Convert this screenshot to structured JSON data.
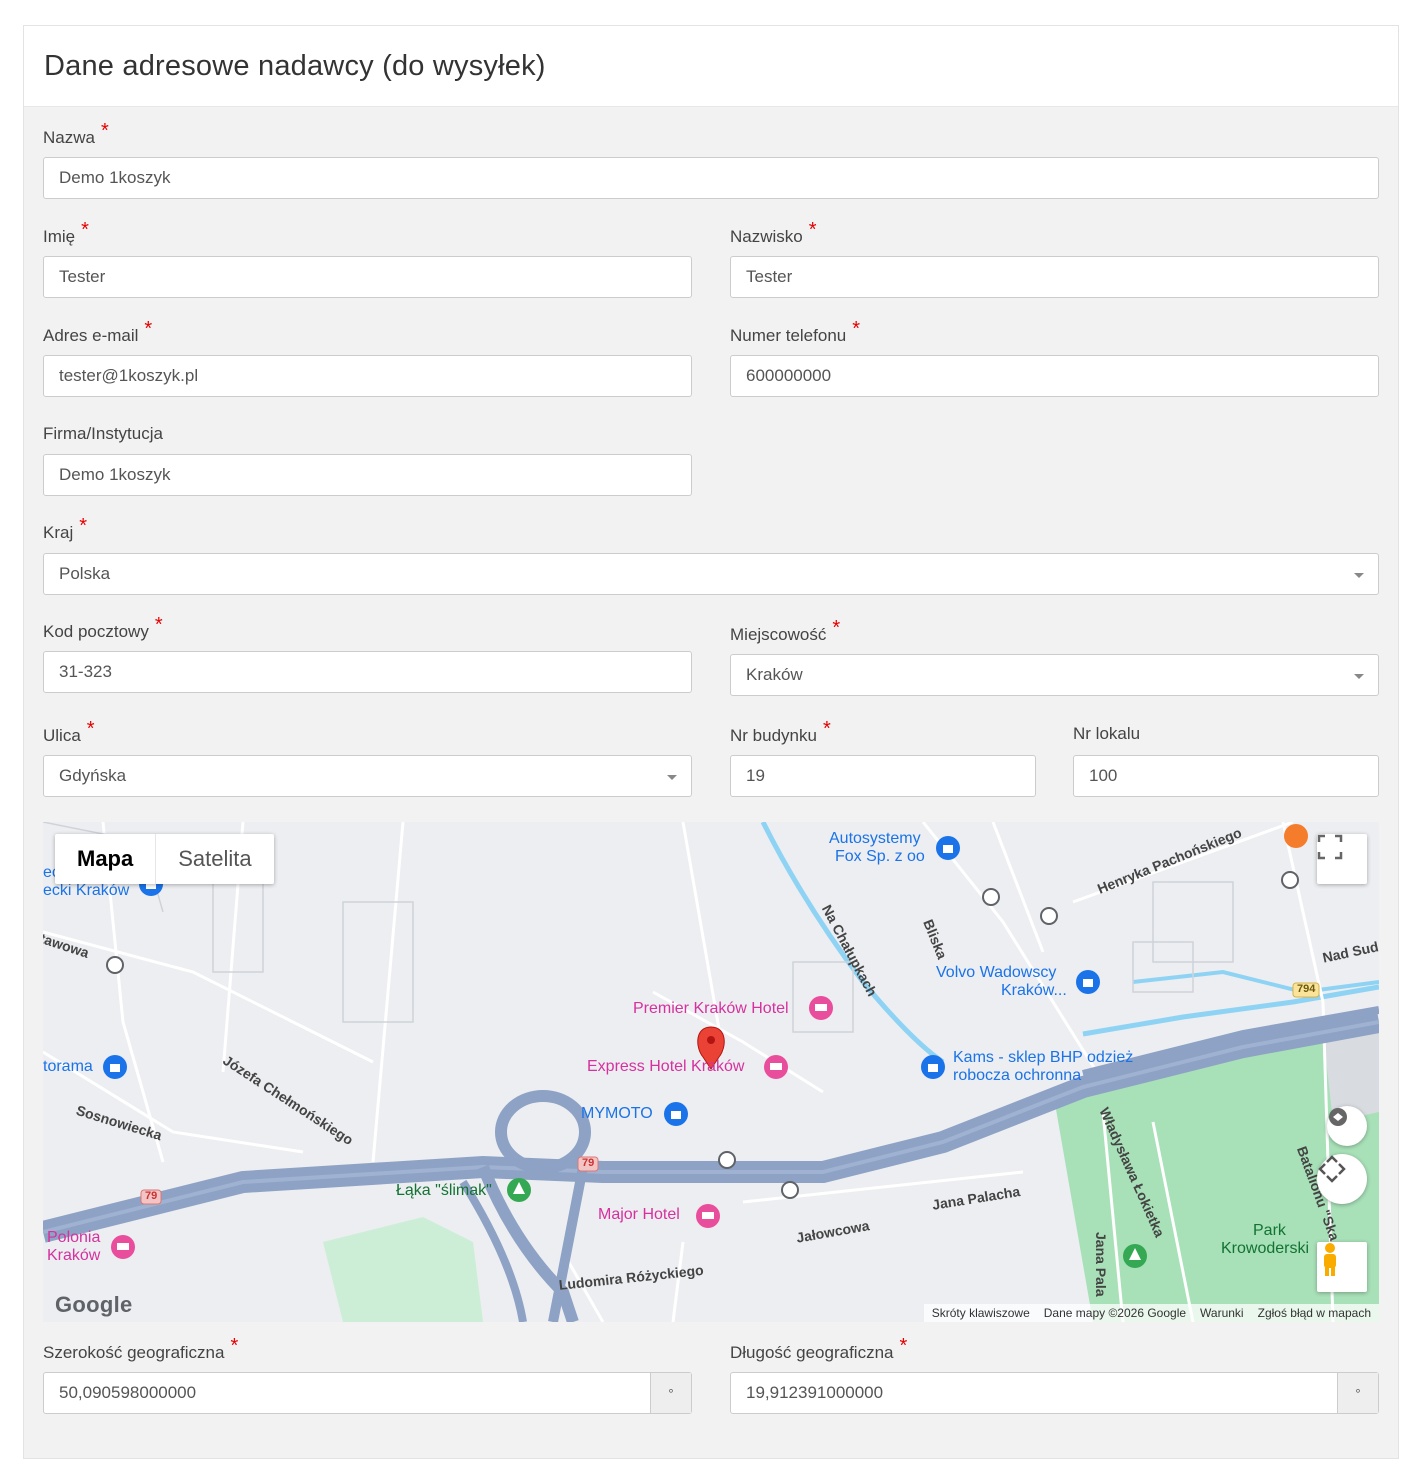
{
  "panel": {
    "title": "Dane adresowe nadawcy (do wysyłek)"
  },
  "fields": {
    "nazwa": {
      "label": "Nazwa",
      "value": "Demo 1koszyk"
    },
    "imie": {
      "label": "Imię",
      "value": "Tester"
    },
    "nazwisko": {
      "label": "Nazwisko",
      "value": "Tester"
    },
    "email": {
      "label": "Adres e-mail",
      "value": "tester@1koszyk.pl"
    },
    "telefon": {
      "label": "Numer telefonu",
      "value": "600000000"
    },
    "firma": {
      "label": "Firma/Instytucja",
      "value": "Demo 1koszyk"
    },
    "kraj": {
      "label": "Kraj",
      "value": "Polska"
    },
    "kod": {
      "label": "Kod pocztowy",
      "value": "31-323"
    },
    "miejscowosc": {
      "label": "Miejscowość",
      "value": "Kraków"
    },
    "ulica": {
      "label": "Ulica",
      "value": "Gdyńska"
    },
    "nr_budynku": {
      "label": "Nr budynku",
      "value": "19"
    },
    "nr_lokalu": {
      "label": "Nr lokalu",
      "value": "100"
    },
    "szerokosc": {
      "label": "Szerokość geograficzna",
      "value": "50,090598000000",
      "unit": "°"
    },
    "dlugosc": {
      "label": "Długość geograficzna",
      "value": "19,912391000000",
      "unit": "°"
    }
  },
  "required_mark": "*",
  "map": {
    "map_type_active": "Mapa",
    "map_type_other": "Satelita",
    "logo": "Google",
    "attribution": {
      "shortcuts": "Skróty klawiszowe",
      "data": "Dane mapy ©2026 Google",
      "terms": "Warunki",
      "report": "Zgłoś błąd w mapach"
    },
    "pois": {
      "premier": "Premier Kraków Hotel",
      "express": "Express Hotel Kraków",
      "mymoto": "MYMOTO",
      "major": "Major Hotel",
      "polonia_1": "Polonia",
      "polonia_2": "Kraków",
      "laka": "Łąka \"ślimak\"",
      "autosystemy_1": "Autosystemy",
      "autosystemy_2": "Fox Sp. z oo",
      "volvo_1": "Volvo Wadowscy",
      "volvo_2": "Kraków...",
      "kams_1": "Kams - sklep BHP odzież",
      "kams_2": "robocza ochronna",
      "park_1": "Park",
      "park_2": "Krowoderski",
      "orama": "torama",
      "ecki_1": "ec",
      "ecki_2": "ecki Kraków"
    },
    "streets": {
      "chelmonskiego": "Józefa Chełmońskiego",
      "sosnowiecka": "Sosnowiecka",
      "stawowa": "tawowa",
      "na_chalupkach": "Na Chałupkach",
      "bliska": "Bliska",
      "pachonskiego": "Henryka Pachońskiego",
      "nad_sud": "Nad Sud",
      "lokietka": "Władysława Łokietka",
      "palacha": "Jana Palacha",
      "jalowcowa": "Jałowcowa",
      "rozyckiego": "Ludomira Różyckiego",
      "batalionu": "Batalionu \"Ska",
      "jana_pala": "Jana Pala",
      "route_79a": "79",
      "route_79b": "79",
      "route_794": "794"
    }
  }
}
